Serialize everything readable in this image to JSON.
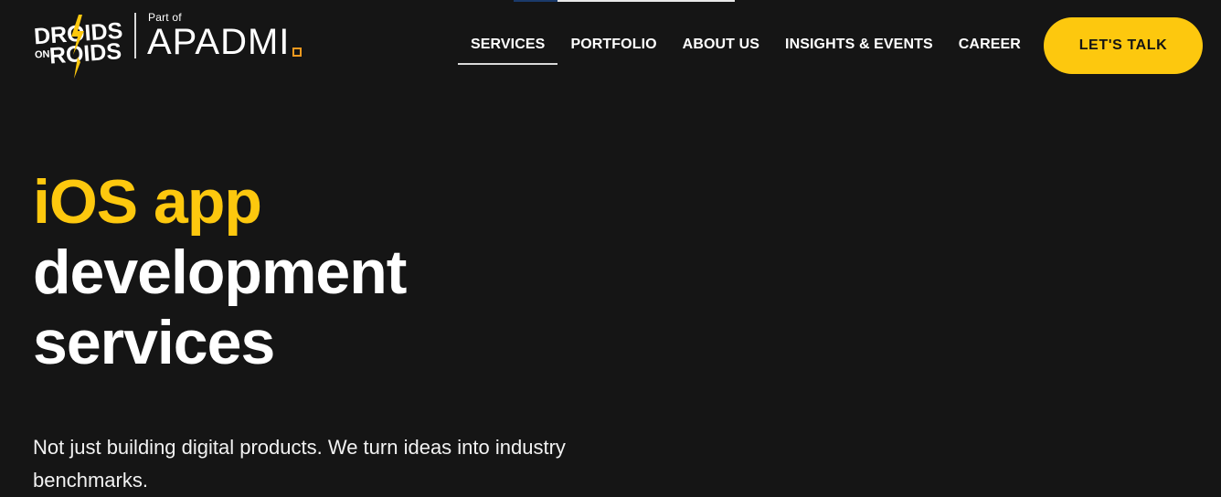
{
  "logo": {
    "brand_line1": "DROIDS",
    "brand_line2": "ON ROIDS",
    "part_of": "Part of",
    "parent_brand": "APADMI",
    "accent_color": "#f39a1f"
  },
  "nav": {
    "items": [
      {
        "label": "SERVICES",
        "active": true
      },
      {
        "label": "PORTFOLIO",
        "active": false
      },
      {
        "label": "ABOUT US",
        "active": false
      },
      {
        "label": "INSIGHTS & EVENTS",
        "active": false
      },
      {
        "label": "CAREER",
        "active": false
      }
    ],
    "cta_label": "LET'S TALK"
  },
  "hero": {
    "title_accent": "iOS app",
    "title_line2": "development",
    "title_line3": "services",
    "subtitle": "Not just building digital products. We turn ideas into industry benchmarks."
  },
  "colors": {
    "background": "#151515",
    "brand_yellow": "#fdc80e",
    "text": "#ffffff"
  }
}
